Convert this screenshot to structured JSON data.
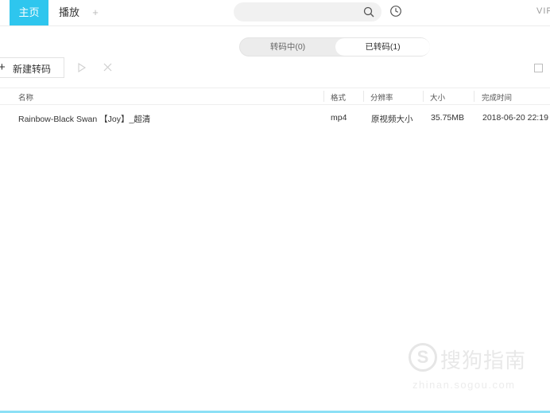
{
  "top_tabs": {
    "home": "主页",
    "play": "播放",
    "add": "+"
  },
  "vip": "VIP",
  "search": {
    "placeholder": ""
  },
  "segments": {
    "converting": "转码中(0)",
    "converted": "已转码(1)"
  },
  "toolbar": {
    "new_label": "新建转码",
    "plus": "+"
  },
  "table": {
    "headers": {
      "name": "名称",
      "format": "格式",
      "resolution": "分辨率",
      "size": "大小",
      "time": "完成时间"
    },
    "rows": [
      {
        "name": "Rainbow-Black Swan 【Joy】_超清",
        "format": "mp4",
        "resolution": "原视频大小",
        "size": "35.75MB",
        "time": "2018-06-20 22:19"
      }
    ]
  },
  "watermark": {
    "logo": "S",
    "text": "搜狗指南",
    "url": "zhinan.sogou.com"
  },
  "colors": {
    "accent": "#2ec6ee"
  },
  "icons": [
    "search-icon",
    "clock-icon",
    "play-icon",
    "close-icon",
    "checkbox-icon"
  ]
}
